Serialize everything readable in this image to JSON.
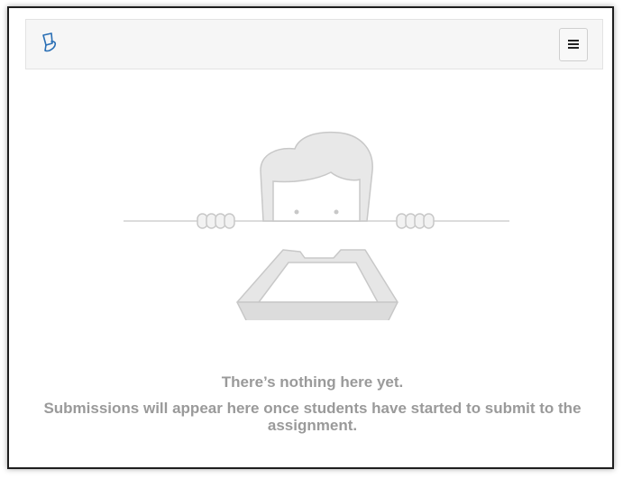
{
  "header": {
    "logo_icon": "canvas-teacher-logo-icon",
    "menu_icon": "hamburger-menu-icon"
  },
  "empty_state": {
    "illustration": "character-peeking-over-inbox-tray",
    "title": "There’s nothing here yet.",
    "description": "Submissions will appear here once students have started to submit to the assignment."
  },
  "colors": {
    "logo_blue": "#2a6fb5",
    "text_gray": "#9a9a9a",
    "illustration_gray": "#dcdcdc"
  }
}
